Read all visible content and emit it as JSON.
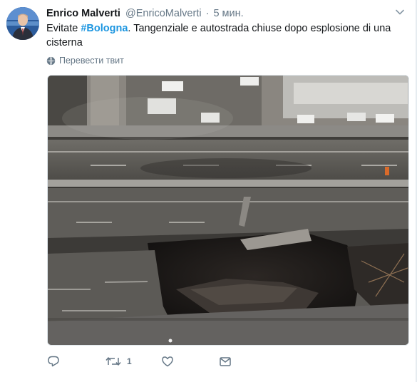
{
  "tweet": {
    "author_name": "Enrico Malverti",
    "author_handle": "@EnricoMalverti",
    "separator": "·",
    "time": "5 мин.",
    "text_before": "Evitate ",
    "hashtag": "#Bologna",
    "text_after": ". Tangenziale e autostrada chiuse dopo esplosione di una cisterna",
    "translate_label": "Перевести твит"
  },
  "actions": {
    "reply_count": "",
    "retweet_count": "1",
    "like_count": ""
  },
  "icons": {
    "avatar": "avatar-icon",
    "caret": "chevron-down-icon",
    "translate": "globe-icon",
    "reply": "reply-icon",
    "retweet": "retweet-icon",
    "like": "heart-icon",
    "message": "envelope-icon"
  },
  "colors": {
    "hashtag": "#1b95e0",
    "secondary_text": "#657786"
  }
}
